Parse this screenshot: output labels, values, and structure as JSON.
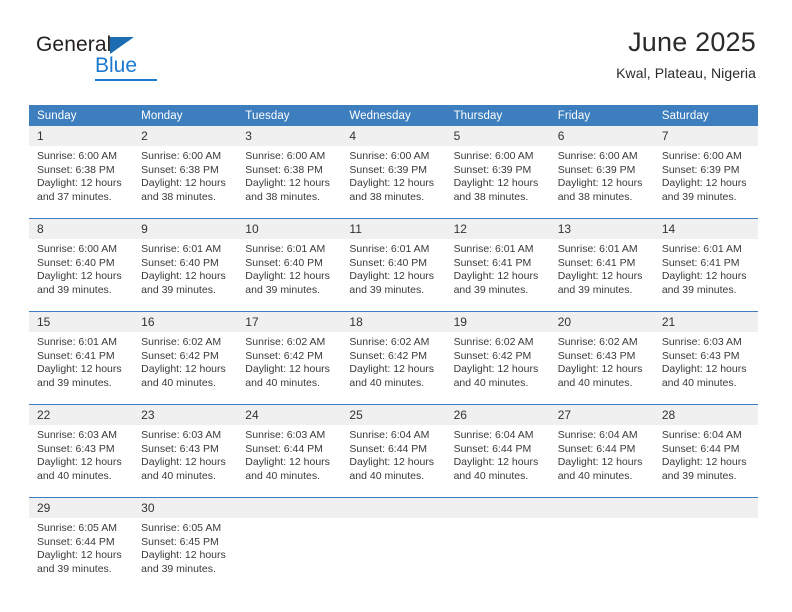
{
  "brand": {
    "name_part1": "General",
    "name_part2": "Blue",
    "triangle_color": "#1b6cb0",
    "blue_color": "#1b7ad0"
  },
  "header": {
    "title": "June 2025",
    "subtitle": "Kwal, Plateau, Nigeria",
    "header_bg": "#3d7ebf",
    "daynum_bg": "#f0f0f0"
  },
  "weekdays": [
    "Sunday",
    "Monday",
    "Tuesday",
    "Wednesday",
    "Thursday",
    "Friday",
    "Saturday"
  ],
  "weeks": [
    {
      "days": [
        {
          "num": "1",
          "sunrise": "Sunrise: 6:00 AM",
          "sunset": "Sunset: 6:38 PM",
          "daylight_1": "Daylight: 12 hours",
          "daylight_2": "and 37 minutes."
        },
        {
          "num": "2",
          "sunrise": "Sunrise: 6:00 AM",
          "sunset": "Sunset: 6:38 PM",
          "daylight_1": "Daylight: 12 hours",
          "daylight_2": "and 38 minutes."
        },
        {
          "num": "3",
          "sunrise": "Sunrise: 6:00 AM",
          "sunset": "Sunset: 6:38 PM",
          "daylight_1": "Daylight: 12 hours",
          "daylight_2": "and 38 minutes."
        },
        {
          "num": "4",
          "sunrise": "Sunrise: 6:00 AM",
          "sunset": "Sunset: 6:39 PM",
          "daylight_1": "Daylight: 12 hours",
          "daylight_2": "and 38 minutes."
        },
        {
          "num": "5",
          "sunrise": "Sunrise: 6:00 AM",
          "sunset": "Sunset: 6:39 PM",
          "daylight_1": "Daylight: 12 hours",
          "daylight_2": "and 38 minutes."
        },
        {
          "num": "6",
          "sunrise": "Sunrise: 6:00 AM",
          "sunset": "Sunset: 6:39 PM",
          "daylight_1": "Daylight: 12 hours",
          "daylight_2": "and 38 minutes."
        },
        {
          "num": "7",
          "sunrise": "Sunrise: 6:00 AM",
          "sunset": "Sunset: 6:39 PM",
          "daylight_1": "Daylight: 12 hours",
          "daylight_2": "and 39 minutes."
        }
      ]
    },
    {
      "days": [
        {
          "num": "8",
          "sunrise": "Sunrise: 6:00 AM",
          "sunset": "Sunset: 6:40 PM",
          "daylight_1": "Daylight: 12 hours",
          "daylight_2": "and 39 minutes."
        },
        {
          "num": "9",
          "sunrise": "Sunrise: 6:01 AM",
          "sunset": "Sunset: 6:40 PM",
          "daylight_1": "Daylight: 12 hours",
          "daylight_2": "and 39 minutes."
        },
        {
          "num": "10",
          "sunrise": "Sunrise: 6:01 AM",
          "sunset": "Sunset: 6:40 PM",
          "daylight_1": "Daylight: 12 hours",
          "daylight_2": "and 39 minutes."
        },
        {
          "num": "11",
          "sunrise": "Sunrise: 6:01 AM",
          "sunset": "Sunset: 6:40 PM",
          "daylight_1": "Daylight: 12 hours",
          "daylight_2": "and 39 minutes."
        },
        {
          "num": "12",
          "sunrise": "Sunrise: 6:01 AM",
          "sunset": "Sunset: 6:41 PM",
          "daylight_1": "Daylight: 12 hours",
          "daylight_2": "and 39 minutes."
        },
        {
          "num": "13",
          "sunrise": "Sunrise: 6:01 AM",
          "sunset": "Sunset: 6:41 PM",
          "daylight_1": "Daylight: 12 hours",
          "daylight_2": "and 39 minutes."
        },
        {
          "num": "14",
          "sunrise": "Sunrise: 6:01 AM",
          "sunset": "Sunset: 6:41 PM",
          "daylight_1": "Daylight: 12 hours",
          "daylight_2": "and 39 minutes."
        }
      ]
    },
    {
      "days": [
        {
          "num": "15",
          "sunrise": "Sunrise: 6:01 AM",
          "sunset": "Sunset: 6:41 PM",
          "daylight_1": "Daylight: 12 hours",
          "daylight_2": "and 39 minutes."
        },
        {
          "num": "16",
          "sunrise": "Sunrise: 6:02 AM",
          "sunset": "Sunset: 6:42 PM",
          "daylight_1": "Daylight: 12 hours",
          "daylight_2": "and 40 minutes."
        },
        {
          "num": "17",
          "sunrise": "Sunrise: 6:02 AM",
          "sunset": "Sunset: 6:42 PM",
          "daylight_1": "Daylight: 12 hours",
          "daylight_2": "and 40 minutes."
        },
        {
          "num": "18",
          "sunrise": "Sunrise: 6:02 AM",
          "sunset": "Sunset: 6:42 PM",
          "daylight_1": "Daylight: 12 hours",
          "daylight_2": "and 40 minutes."
        },
        {
          "num": "19",
          "sunrise": "Sunrise: 6:02 AM",
          "sunset": "Sunset: 6:42 PM",
          "daylight_1": "Daylight: 12 hours",
          "daylight_2": "and 40 minutes."
        },
        {
          "num": "20",
          "sunrise": "Sunrise: 6:02 AM",
          "sunset": "Sunset: 6:43 PM",
          "daylight_1": "Daylight: 12 hours",
          "daylight_2": "and 40 minutes."
        },
        {
          "num": "21",
          "sunrise": "Sunrise: 6:03 AM",
          "sunset": "Sunset: 6:43 PM",
          "daylight_1": "Daylight: 12 hours",
          "daylight_2": "and 40 minutes."
        }
      ]
    },
    {
      "days": [
        {
          "num": "22",
          "sunrise": "Sunrise: 6:03 AM",
          "sunset": "Sunset: 6:43 PM",
          "daylight_1": "Daylight: 12 hours",
          "daylight_2": "and 40 minutes."
        },
        {
          "num": "23",
          "sunrise": "Sunrise: 6:03 AM",
          "sunset": "Sunset: 6:43 PM",
          "daylight_1": "Daylight: 12 hours",
          "daylight_2": "and 40 minutes."
        },
        {
          "num": "24",
          "sunrise": "Sunrise: 6:03 AM",
          "sunset": "Sunset: 6:44 PM",
          "daylight_1": "Daylight: 12 hours",
          "daylight_2": "and 40 minutes."
        },
        {
          "num": "25",
          "sunrise": "Sunrise: 6:04 AM",
          "sunset": "Sunset: 6:44 PM",
          "daylight_1": "Daylight: 12 hours",
          "daylight_2": "and 40 minutes."
        },
        {
          "num": "26",
          "sunrise": "Sunrise: 6:04 AM",
          "sunset": "Sunset: 6:44 PM",
          "daylight_1": "Daylight: 12 hours",
          "daylight_2": "and 40 minutes."
        },
        {
          "num": "27",
          "sunrise": "Sunrise: 6:04 AM",
          "sunset": "Sunset: 6:44 PM",
          "daylight_1": "Daylight: 12 hours",
          "daylight_2": "and 40 minutes."
        },
        {
          "num": "28",
          "sunrise": "Sunrise: 6:04 AM",
          "sunset": "Sunset: 6:44 PM",
          "daylight_1": "Daylight: 12 hours",
          "daylight_2": "and 39 minutes."
        }
      ]
    },
    {
      "days": [
        {
          "num": "29",
          "sunrise": "Sunrise: 6:05 AM",
          "sunset": "Sunset: 6:44 PM",
          "daylight_1": "Daylight: 12 hours",
          "daylight_2": "and 39 minutes."
        },
        {
          "num": "30",
          "sunrise": "Sunrise: 6:05 AM",
          "sunset": "Sunset: 6:45 PM",
          "daylight_1": "Daylight: 12 hours",
          "daylight_2": "and 39 minutes."
        },
        {
          "num": "",
          "sunrise": "",
          "sunset": "",
          "daylight_1": "",
          "daylight_2": ""
        },
        {
          "num": "",
          "sunrise": "",
          "sunset": "",
          "daylight_1": "",
          "daylight_2": ""
        },
        {
          "num": "",
          "sunrise": "",
          "sunset": "",
          "daylight_1": "",
          "daylight_2": ""
        },
        {
          "num": "",
          "sunrise": "",
          "sunset": "",
          "daylight_1": "",
          "daylight_2": ""
        },
        {
          "num": "",
          "sunrise": "",
          "sunset": "",
          "daylight_1": "",
          "daylight_2": ""
        }
      ]
    }
  ]
}
